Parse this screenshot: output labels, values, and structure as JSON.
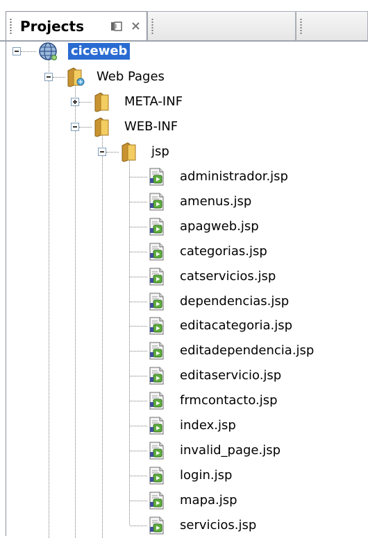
{
  "panel": {
    "title": "Projects"
  },
  "tree": {
    "project": "ciceweb",
    "web_pages": "Web Pages",
    "meta_inf": "META-INF",
    "web_inf": "WEB-INF",
    "jsp": "jsp",
    "files": [
      "administrador.jsp",
      "amenus.jsp",
      "apagweb.jsp",
      "categorias.jsp",
      "catservicios.jsp",
      "dependencias.jsp",
      "editacategoria.jsp",
      "editadependencia.jsp",
      "editaservicio.jsp",
      "frmcontacto.jsp",
      "index.jsp",
      "invalid_page.jsp",
      "login.jsp",
      "mapa.jsp",
      "servicios.jsp"
    ]
  },
  "colors": {
    "selection": "#2a6bd2",
    "folder": "#e8b84a"
  }
}
